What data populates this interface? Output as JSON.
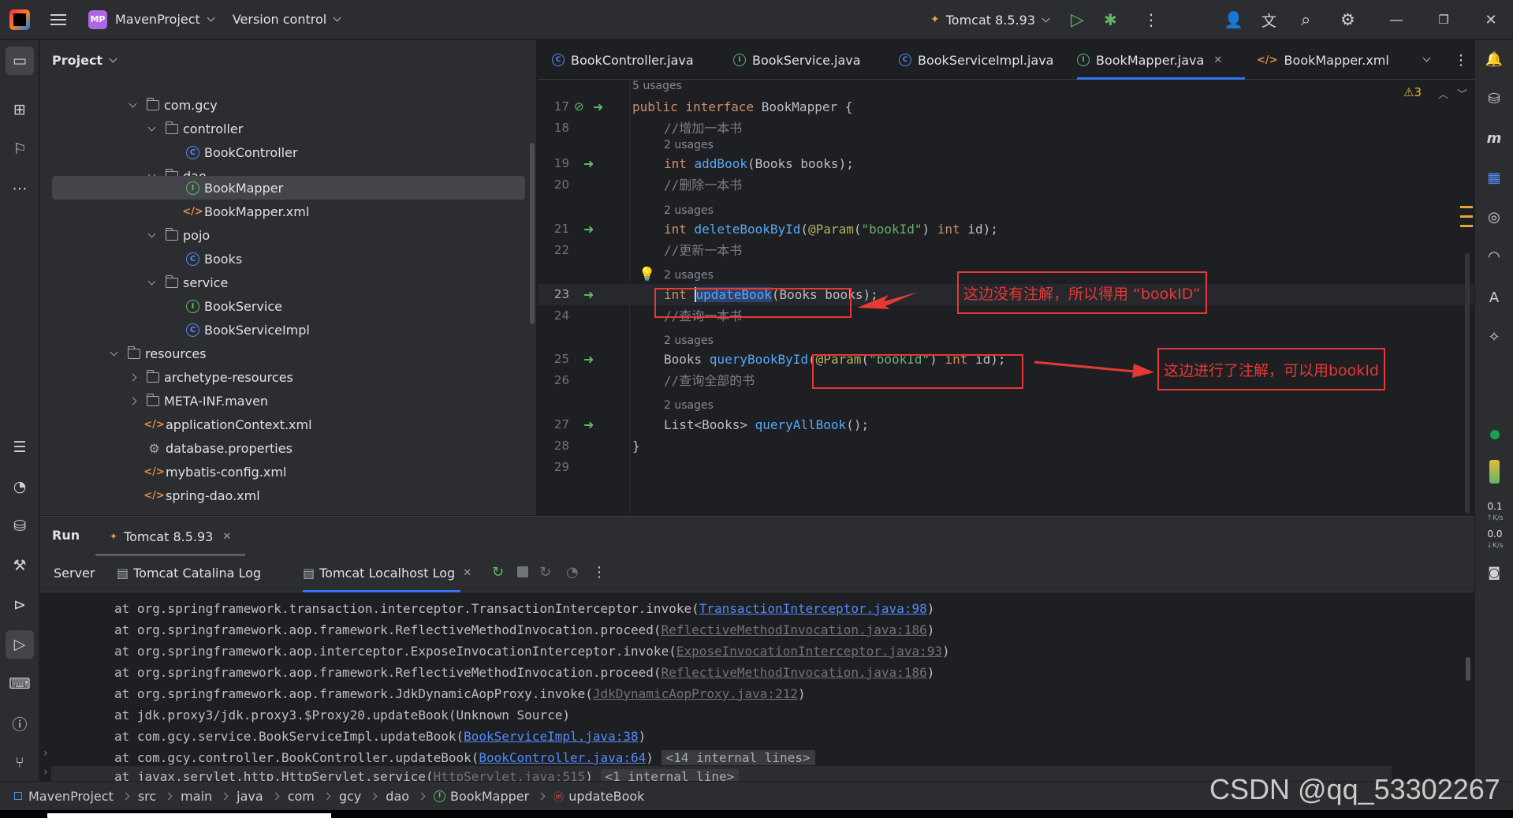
{
  "titlebar": {
    "project_badge": "MP",
    "project_name": "MavenProject",
    "vcs": "Version control",
    "run_config": "Tomcat 8.5.93"
  },
  "project_panel": {
    "title": "Project",
    "rows": [
      {
        "label": "com.gcy"
      },
      {
        "label": "controller"
      },
      {
        "label": "BookController"
      },
      {
        "label": "dao"
      },
      {
        "label": "BookMapper"
      },
      {
        "label": "BookMapper.xml"
      },
      {
        "label": "pojo"
      },
      {
        "label": "Books"
      },
      {
        "label": "service"
      },
      {
        "label": "BookService"
      },
      {
        "label": "BookServiceImpl"
      },
      {
        "label": "resources"
      },
      {
        "label": "archetype-resources"
      },
      {
        "label": "META-INF.maven"
      },
      {
        "label": "applicationContext.xml"
      },
      {
        "label": "database.properties"
      },
      {
        "label": "mybatis-config.xml"
      },
      {
        "label": "spring-dao.xml"
      }
    ]
  },
  "editor": {
    "tabs": [
      {
        "label": "BookController.java"
      },
      {
        "label": "BookService.java"
      },
      {
        "label": "BookServiceImpl.java"
      },
      {
        "label": "BookMapper.java"
      },
      {
        "label": "BookMapper.xml"
      }
    ],
    "warning_count": "3",
    "usages_top": "5 usages",
    "usages": "2 usages",
    "line_numbers": [
      "17",
      "18",
      "19",
      "20",
      "21",
      "22",
      "23",
      "24",
      "25",
      "26",
      "27",
      "28",
      "29"
    ],
    "code": {
      "l17_kw": "public interface ",
      "l17_name": "BookMapper {",
      "l18": "//增加一本书",
      "l19_kw": "int ",
      "l19_fn": "addBook",
      "l19_rest": "(Books books);",
      "l20": "//删除一本书",
      "l21_kw": "int ",
      "l21_fn": "deleteBookById",
      "l21_a": "(",
      "l21_ann": "@Param",
      "l21_b": "(",
      "l21_str": "\"bookId\"",
      "l21_c": ") ",
      "l21_kw2": "int ",
      "l21_d": "id);",
      "l22": "//更新一本书",
      "l23_kw": "int ",
      "l23_fn": "updateBook",
      "l23_rest": "(Books books);",
      "l24": "//查询一本书",
      "l25_type": "Books ",
      "l25_fn": "queryBookById",
      "l25_a": "(",
      "l25_ann": "@Param",
      "l25_b": "(",
      "l25_str": "\"bookId\"",
      "l25_c": ") ",
      "l25_kw2": "int ",
      "l25_d": "id);",
      "l26": "//查询全部的书",
      "l27_type": "List<Books> ",
      "l27_fn": "queryAllBook",
      "l27_rest": "();",
      "l28": "}"
    },
    "annotations": {
      "a1": "这边没有注解，所以得用 “bookID”",
      "a2": "这边进行了注解，可以用bookId"
    }
  },
  "run_panel": {
    "title": "Run",
    "config_tab": "Tomcat 8.5.93",
    "subtabs": [
      "Server",
      "Tomcat Catalina Log",
      "Tomcat Localhost Log"
    ],
    "log": [
      {
        "pre": "at org.springframework.transaction.interceptor.TransactionInterceptor.invoke(",
        "link": "TransactionInterceptor.java:98",
        "post": ")"
      },
      {
        "pre": "at org.springframework.aop.framework.ReflectiveMethodInvocation.proceed(",
        "link": "ReflectiveMethodInvocation.java:186",
        "post": ")"
      },
      {
        "pre": "at org.springframework.aop.interceptor.ExposeInvocationInterceptor.invoke(",
        "link": "ExposeInvocationInterceptor.java:93",
        "post": ")"
      },
      {
        "pre": "at org.springframework.aop.framework.ReflectiveMethodInvocation.proceed(",
        "link": "ReflectiveMethodInvocation.java:186",
        "post": ")"
      },
      {
        "pre": "at org.springframework.aop.framework.JdkDynamicAopProxy.invoke(",
        "link": "JdkDynamicAopProxy.java:212",
        "post": ")"
      },
      {
        "pre": "at jdk.proxy3/jdk.proxy3.$Proxy20.updateBook(Unknown Source)",
        "link": "",
        "post": ""
      },
      {
        "pre": "at com.gcy.service.BookServiceImpl.updateBook(",
        "link": "BookServiceImpl.java:38",
        "post": ")"
      },
      {
        "pre": "at com.gcy.controller.BookController.updateBook(",
        "link": "BookController.java:64",
        "post": ") ",
        "internal": "<14 internal lines>"
      },
      {
        "pre": "at javax.servlet.http.HttpServlet.service(",
        "link": "HttpServlet.java:515",
        "post": ") ",
        "internal": "<1 internal line>"
      }
    ]
  },
  "status_bar": {
    "breadcrumbs": [
      "MavenProject",
      "src",
      "main",
      "java",
      "com",
      "gcy",
      "dao",
      "BookMapper",
      "updateBook"
    ]
  },
  "right_strip": {
    "net_up": "0.1",
    "net_down": "0.0",
    "net_unit": "K/s"
  },
  "watermark": "CSDN @qq_53302267",
  "colors": {
    "accent": "#3574f0",
    "keyword": "#cf8e6d",
    "function": "#56a8f5",
    "string": "#6aab73",
    "annotation_red": "#e53935"
  }
}
